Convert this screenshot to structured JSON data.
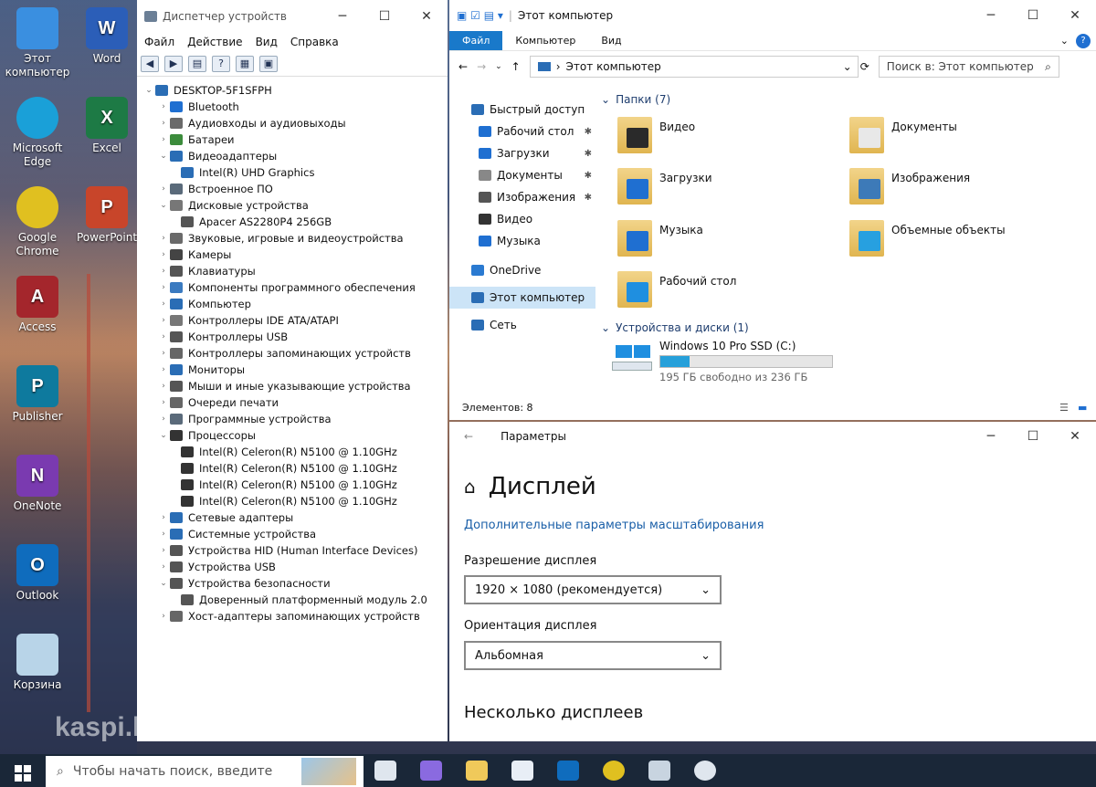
{
  "desktop": {
    "icons": [
      {
        "label": "Этот компьютер",
        "icon": "this-pc-icon"
      },
      {
        "label": "Word",
        "icon": "word-icon"
      },
      {
        "label": "Microsoft Edge",
        "icon": "edge-icon"
      },
      {
        "label": "Excel",
        "icon": "excel-icon"
      },
      {
        "label": "Google Chrome",
        "icon": "chrome-icon"
      },
      {
        "label": "PowerPoint",
        "icon": "powerpoint-icon"
      },
      {
        "label": "Access",
        "icon": "access-icon"
      },
      {
        "label": "Publisher",
        "icon": "publisher-icon"
      },
      {
        "label": "OneNote",
        "icon": "onenote-icon"
      },
      {
        "label": "Outlook",
        "icon": "outlook-icon"
      },
      {
        "label": "Корзина",
        "icon": "recycle-bin-icon"
      }
    ],
    "watermark": "kaspi.kz"
  },
  "device_manager": {
    "title": "Диспетчер устройств",
    "menu": [
      "Файл",
      "Действие",
      "Вид",
      "Справка"
    ],
    "root": "DESKTOP-5F1SFPH",
    "items": [
      {
        "label": "Bluetooth",
        "level": 1,
        "expanded": false,
        "color": "#1f6fd1"
      },
      {
        "label": "Аудиовходы и аудиовыходы",
        "level": 1,
        "expanded": false,
        "color": "#6a6a6a"
      },
      {
        "label": "Батареи",
        "level": 1,
        "expanded": false,
        "color": "#3c8c3c"
      },
      {
        "label": "Видеоадаптеры",
        "level": 1,
        "expanded": true,
        "color": "#2a6db5"
      },
      {
        "label": "Intel(R) UHD Graphics",
        "level": 2,
        "color": "#2a6db5"
      },
      {
        "label": "Встроенное ПО",
        "level": 1,
        "expanded": false,
        "color": "#5a6a7a"
      },
      {
        "label": "Дисковые устройства",
        "level": 1,
        "expanded": true,
        "color": "#777"
      },
      {
        "label": "Apacer AS2280P4 256GB",
        "level": 2,
        "color": "#555"
      },
      {
        "label": "Звуковые, игровые и видеоустройства",
        "level": 1,
        "expanded": false,
        "color": "#6a6a6a"
      },
      {
        "label": "Камеры",
        "level": 1,
        "expanded": false,
        "color": "#444"
      },
      {
        "label": "Клавиатуры",
        "level": 1,
        "expanded": false,
        "color": "#555"
      },
      {
        "label": "Компоненты программного обеспечения",
        "level": 1,
        "expanded": false,
        "color": "#3a7ac0"
      },
      {
        "label": "Компьютер",
        "level": 1,
        "expanded": false,
        "color": "#2a6db5"
      },
      {
        "label": "Контроллеры IDE ATA/ATAPI",
        "level": 1,
        "expanded": false,
        "color": "#777"
      },
      {
        "label": "Контроллеры USB",
        "level": 1,
        "expanded": false,
        "color": "#555"
      },
      {
        "label": "Контроллеры запоминающих устройств",
        "level": 1,
        "expanded": false,
        "color": "#666"
      },
      {
        "label": "Мониторы",
        "level": 1,
        "expanded": false,
        "color": "#2a6db5"
      },
      {
        "label": "Мыши и иные указывающие устройства",
        "level": 1,
        "expanded": false,
        "color": "#555"
      },
      {
        "label": "Очереди печати",
        "level": 1,
        "expanded": false,
        "color": "#666"
      },
      {
        "label": "Программные устройства",
        "level": 1,
        "expanded": false,
        "color": "#5a6a7a"
      },
      {
        "label": "Процессоры",
        "level": 1,
        "expanded": true,
        "color": "#333"
      },
      {
        "label": "Intel(R) Celeron(R) N5100 @ 1.10GHz",
        "level": 2,
        "color": "#333"
      },
      {
        "label": "Intel(R) Celeron(R) N5100 @ 1.10GHz",
        "level": 2,
        "color": "#333"
      },
      {
        "label": "Intel(R) Celeron(R) N5100 @ 1.10GHz",
        "level": 2,
        "color": "#333"
      },
      {
        "label": "Intel(R) Celeron(R) N5100 @ 1.10GHz",
        "level": 2,
        "color": "#333"
      },
      {
        "label": "Сетевые адаптеры",
        "level": 1,
        "expanded": false,
        "color": "#2a6db5"
      },
      {
        "label": "Системные устройства",
        "level": 1,
        "expanded": false,
        "color": "#2a6db5"
      },
      {
        "label": "Устройства HID (Human Interface Devices)",
        "level": 1,
        "expanded": false,
        "color": "#555"
      },
      {
        "label": "Устройства USB",
        "level": 1,
        "expanded": false,
        "color": "#555"
      },
      {
        "label": "Устройства безопасности",
        "level": 1,
        "expanded": true,
        "color": "#555"
      },
      {
        "label": "Доверенный платформенный модуль 2.0",
        "level": 2,
        "color": "#555"
      },
      {
        "label": "Хост-адаптеры запоминающих устройств",
        "level": 1,
        "expanded": false,
        "color": "#666"
      }
    ]
  },
  "explorer": {
    "title": "Этот компьютер",
    "ribbon": [
      "Файл",
      "Компьютер",
      "Вид"
    ],
    "address": "Этот компьютер",
    "search_placeholder": "Поиск в: Этот компьютер",
    "nav": [
      {
        "label": "Быстрый доступ",
        "indent": 0,
        "pin": false,
        "color": "#2a6db5"
      },
      {
        "label": "Рабочий стол",
        "indent": 1,
        "pin": true,
        "color": "#1f6fd1"
      },
      {
        "label": "Загрузки",
        "indent": 1,
        "pin": true,
        "color": "#1f6fd1"
      },
      {
        "label": "Документы",
        "indent": 1,
        "pin": true,
        "color": "#888"
      },
      {
        "label": "Изображения",
        "indent": 1,
        "pin": true,
        "color": "#555"
      },
      {
        "label": "Видео",
        "indent": 1,
        "pin": false,
        "color": "#333"
      },
      {
        "label": "Музыка",
        "indent": 1,
        "pin": false,
        "color": "#1f6fd1"
      },
      {
        "label": "OneDrive",
        "indent": 0,
        "pin": false,
        "color": "#2a7ad1"
      },
      {
        "label": "Этот компьютер",
        "indent": 0,
        "pin": false,
        "selected": true,
        "color": "#2a6db5"
      },
      {
        "label": "Сеть",
        "indent": 0,
        "pin": false,
        "color": "#2a6db5"
      }
    ],
    "folders_header": "Папки (7)",
    "folders": [
      {
        "label": "Видео",
        "overlay": "#2a2a2a"
      },
      {
        "label": "Документы",
        "overlay": "#e8e8e8"
      },
      {
        "label": "Загрузки",
        "overlay": "#1f6fd1"
      },
      {
        "label": "Изображения",
        "overlay": "#3d7ab8"
      },
      {
        "label": "Музыка",
        "overlay": "#1f6fd1"
      },
      {
        "label": "Объемные объекты",
        "overlay": "#27a0e0"
      },
      {
        "label": "Рабочий стол",
        "overlay": "#1f8fe0"
      }
    ],
    "devices_header": "Устройства и диски (1)",
    "drive": {
      "label": "Windows 10 Pro SSD (C:)",
      "free_text": "195 ГБ свободно из 236 ГБ",
      "used_fraction": 0.17
    },
    "status": "Элементов: 8"
  },
  "settings": {
    "title": "Параметры",
    "heading": "Дисплей",
    "link": "Дополнительные параметры масштабирования",
    "resolution_label": "Разрешение дисплея",
    "resolution_value": "1920 × 1080 (рекомендуется)",
    "orientation_label": "Ориентация дисплея",
    "orientation_value": "Альбомная",
    "multi_heading": "Несколько дисплеев"
  },
  "taskbar": {
    "search_placeholder": "Чтобы начать поиск, введите",
    "apps": [
      "task-view-icon",
      "copilot-icon",
      "file-explorer-icon",
      "store-icon",
      "outlook-icon",
      "chrome-icon",
      "device-icon",
      "settings-icon"
    ]
  }
}
